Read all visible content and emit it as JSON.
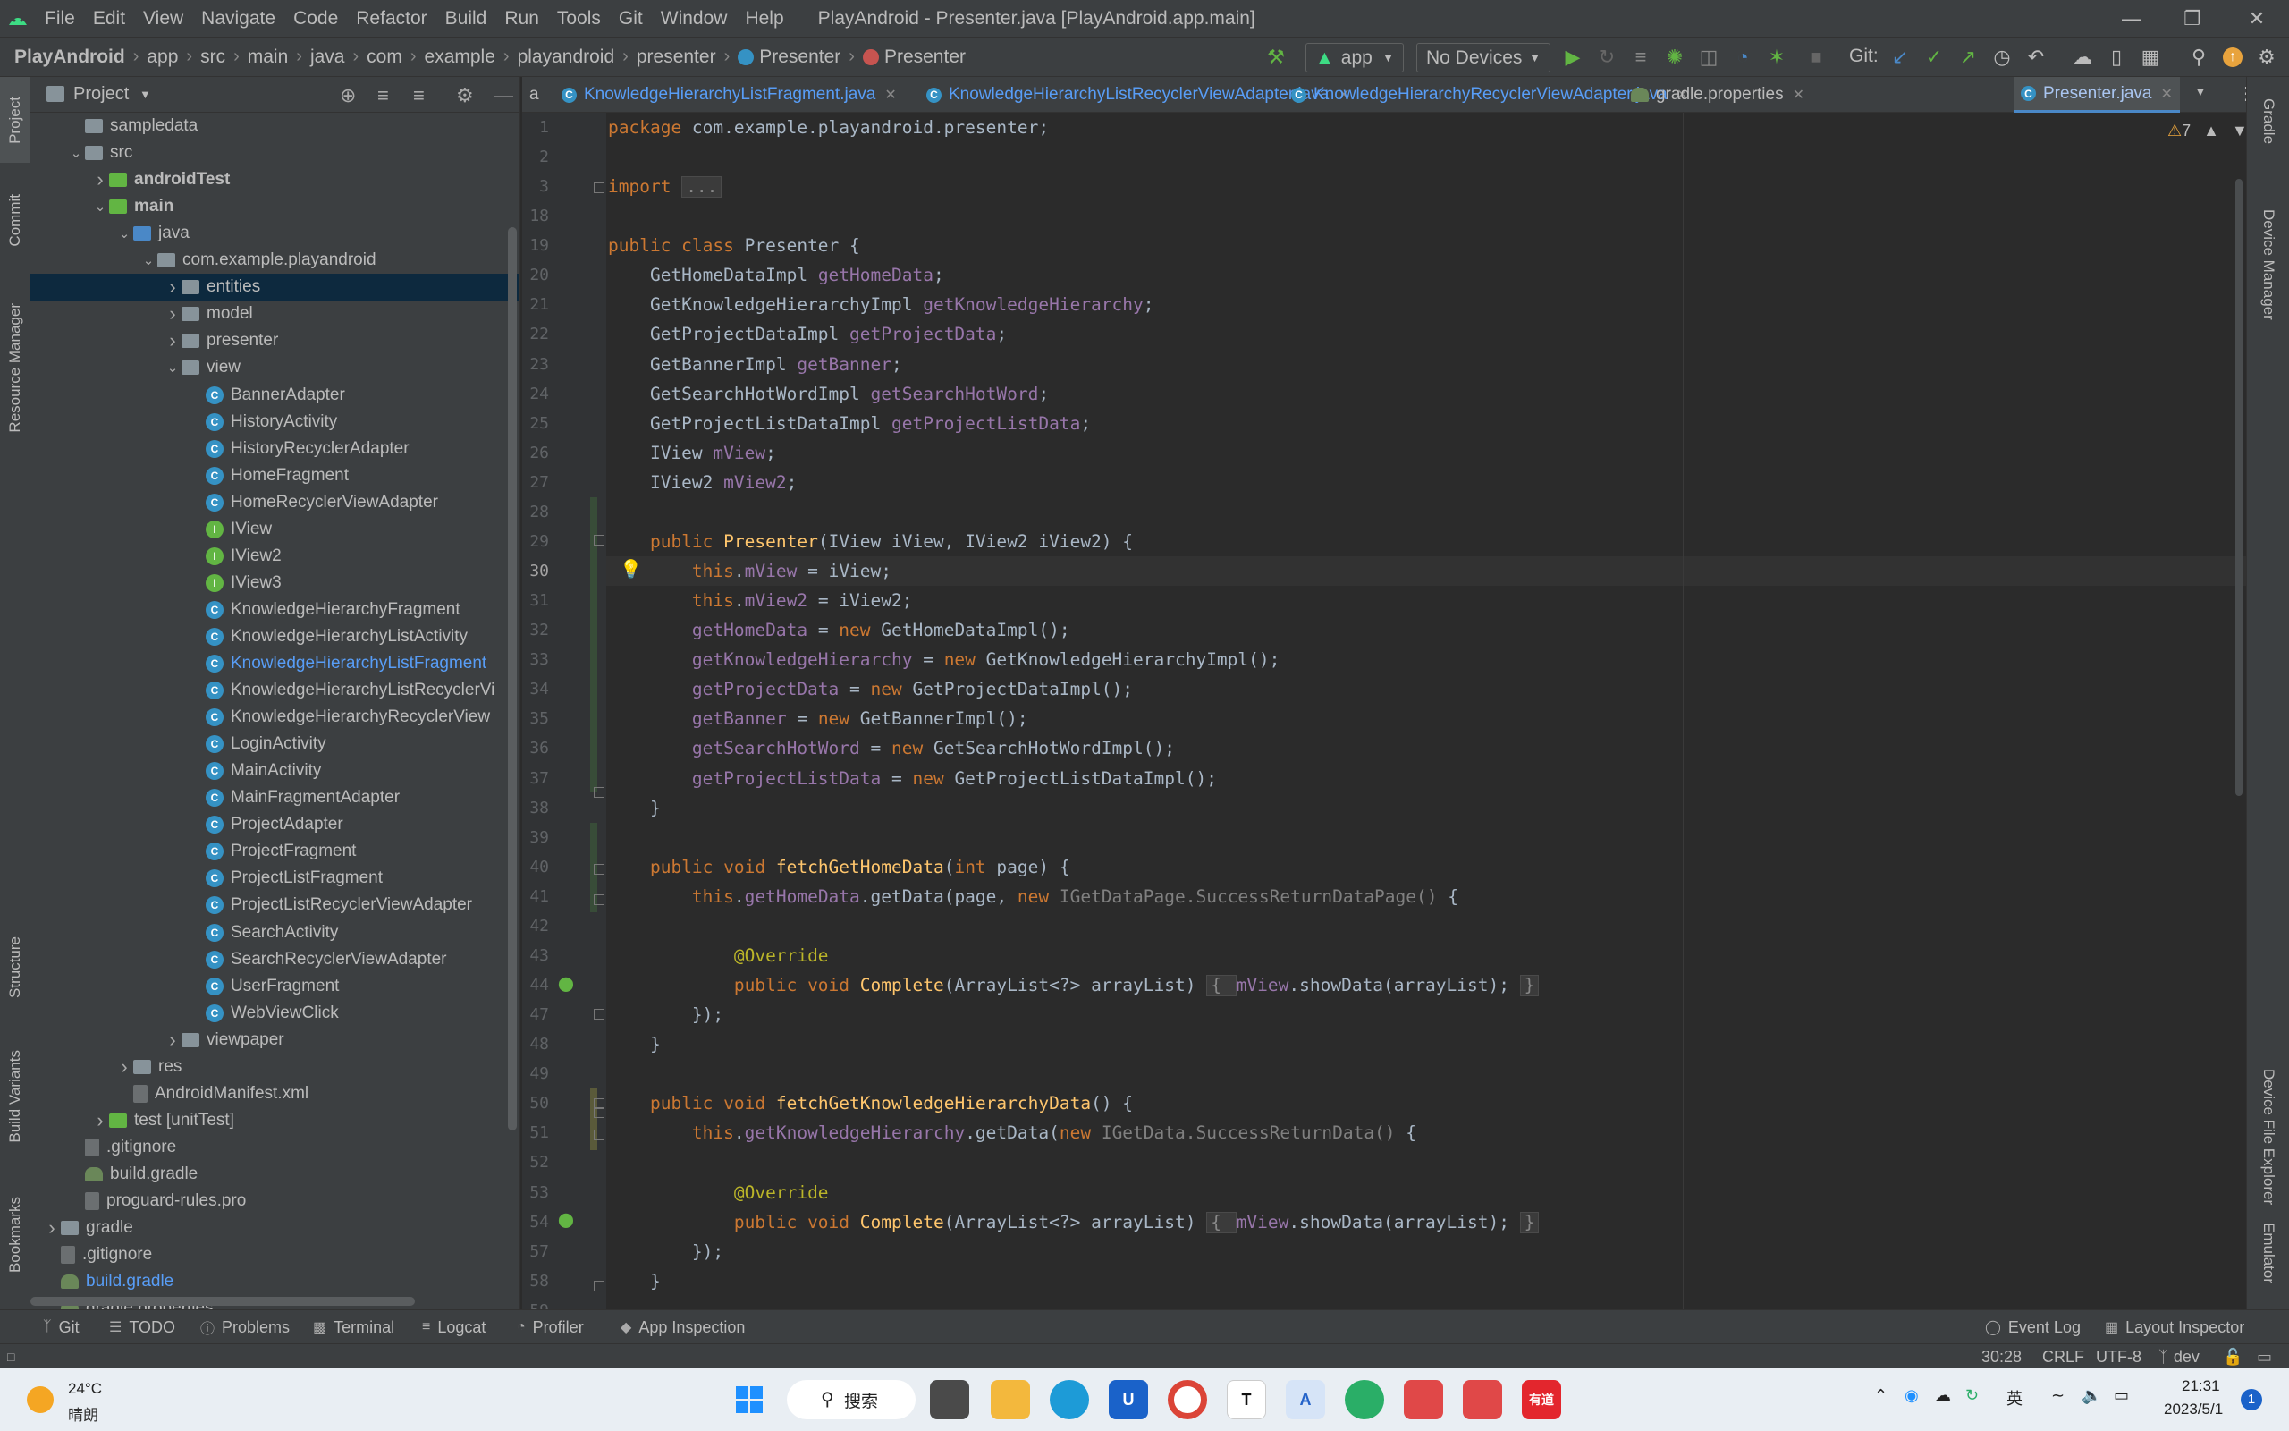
{
  "menu": {
    "items": [
      "File",
      "Edit",
      "View",
      "Navigate",
      "Code",
      "Refactor",
      "Build",
      "Run",
      "Tools",
      "Git",
      "Window",
      "Help"
    ],
    "window_title": "PlayAndroid - Presenter.java [PlayAndroid.app.main]"
  },
  "nav": {
    "breadcrumbs": [
      "PlayAndroid",
      "app",
      "src",
      "main",
      "java",
      "com",
      "example",
      "playandroid",
      "presenter"
    ],
    "class_crumb": "Presenter",
    "member_crumb": "Presenter",
    "run_config": "app",
    "device": "No Devices",
    "git_label": "Git:"
  },
  "left_stripe": {
    "tabs": [
      "Project",
      "Commit",
      "Resource Manager",
      "Structure",
      "Build Variants",
      "Bookmarks"
    ]
  },
  "project": {
    "title": "Project",
    "tree": [
      {
        "label": "sampledata",
        "indent": 1,
        "icon": "folder",
        "arrow": ""
      },
      {
        "label": "src",
        "indent": 1,
        "icon": "folder",
        "arrow": "v"
      },
      {
        "label": "androidTest",
        "indent": 2,
        "icon": "folder-green",
        "arrow": ">",
        "bold": true
      },
      {
        "label": "main",
        "indent": 2,
        "icon": "folder-green",
        "arrow": "v",
        "bold": true
      },
      {
        "label": "java",
        "indent": 3,
        "icon": "folder-blue",
        "arrow": "v"
      },
      {
        "label": "com.example.playandroid",
        "indent": 4,
        "icon": "folder",
        "arrow": "v"
      },
      {
        "label": "entities",
        "indent": 5,
        "icon": "folder",
        "arrow": ">",
        "selected": true
      },
      {
        "label": "model",
        "indent": 5,
        "icon": "folder",
        "arrow": ">"
      },
      {
        "label": "presenter",
        "indent": 5,
        "icon": "folder",
        "arrow": ">"
      },
      {
        "label": "view",
        "indent": 5,
        "icon": "folder",
        "arrow": "v"
      },
      {
        "label": "BannerAdapter",
        "indent": 6,
        "icon": "class"
      },
      {
        "label": "HistoryActivity",
        "indent": 6,
        "icon": "class"
      },
      {
        "label": "HistoryRecyclerAdapter",
        "indent": 6,
        "icon": "class"
      },
      {
        "label": "HomeFragment",
        "indent": 6,
        "icon": "class"
      },
      {
        "label": "HomeRecyclerViewAdapter",
        "indent": 6,
        "icon": "class"
      },
      {
        "label": "IView",
        "indent": 6,
        "icon": "interface"
      },
      {
        "label": "IView2",
        "indent": 6,
        "icon": "interface"
      },
      {
        "label": "IView3",
        "indent": 6,
        "icon": "interface"
      },
      {
        "label": "KnowledgeHierarchyFragment",
        "indent": 6,
        "icon": "class"
      },
      {
        "label": "KnowledgeHierarchyListActivity",
        "indent": 6,
        "icon": "class"
      },
      {
        "label": "KnowledgeHierarchyListFragment",
        "indent": 6,
        "icon": "class",
        "highlight": true
      },
      {
        "label": "KnowledgeHierarchyListRecyclerVi",
        "indent": 6,
        "icon": "class"
      },
      {
        "label": "KnowledgeHierarchyRecyclerView",
        "indent": 6,
        "icon": "class"
      },
      {
        "label": "LoginActivity",
        "indent": 6,
        "icon": "class"
      },
      {
        "label": "MainActivity",
        "indent": 6,
        "icon": "class"
      },
      {
        "label": "MainFragmentAdapter",
        "indent": 6,
        "icon": "class"
      },
      {
        "label": "ProjectAdapter",
        "indent": 6,
        "icon": "class"
      },
      {
        "label": "ProjectFragment",
        "indent": 6,
        "icon": "class"
      },
      {
        "label": "ProjectListFragment",
        "indent": 6,
        "icon": "class"
      },
      {
        "label": "ProjectListRecyclerViewAdapter",
        "indent": 6,
        "icon": "class"
      },
      {
        "label": "SearchActivity",
        "indent": 6,
        "icon": "class"
      },
      {
        "label": "SearchRecyclerViewAdapter",
        "indent": 6,
        "icon": "class"
      },
      {
        "label": "UserFragment",
        "indent": 6,
        "icon": "class"
      },
      {
        "label": "WebViewClick",
        "indent": 6,
        "icon": "class"
      },
      {
        "label": "viewpaper",
        "indent": 5,
        "icon": "folder",
        "arrow": ">"
      },
      {
        "label": "res",
        "indent": 3,
        "icon": "folder",
        "arrow": ">"
      },
      {
        "label": "AndroidManifest.xml",
        "indent": 3,
        "icon": "file"
      },
      {
        "label": "test [unitTest]",
        "indent": 2,
        "icon": "folder-green",
        "arrow": ">"
      },
      {
        "label": ".gitignore",
        "indent": 1,
        "icon": "file"
      },
      {
        "label": "build.gradle",
        "indent": 1,
        "icon": "gradle"
      },
      {
        "label": "proguard-rules.pro",
        "indent": 1,
        "icon": "file"
      },
      {
        "label": "gradle",
        "indent": 0,
        "icon": "folder",
        "arrow": ">"
      },
      {
        "label": ".gitignore",
        "indent": 0,
        "icon": "file"
      },
      {
        "label": "build.gradle",
        "indent": 0,
        "icon": "gradle",
        "highlight": true
      },
      {
        "label": "gradle.properties",
        "indent": 0,
        "icon": "gradle"
      }
    ]
  },
  "tabs": [
    {
      "label": "a",
      "partial": true
    },
    {
      "label": "KnowledgeHierarchyListFragment.java"
    },
    {
      "label": "KnowledgeHierarchyListRecyclerViewAdapter.java"
    },
    {
      "label": "KnowledgeHierarchyRecyclerViewAdapter.java"
    },
    {
      "label": "gradle.properties",
      "gradle": true
    },
    {
      "label": "Presenter.java",
      "active": true
    }
  ],
  "editor": {
    "warning_count": "7",
    "current_line": "30",
    "lines": [
      {
        "n": "1",
        "html": "<span class=\"kw\">package </span>com.example.playandroid.presenter;"
      },
      {
        "n": "2",
        "html": ""
      },
      {
        "n": "3",
        "html": "<span class=\"kw\">import </span><span class=\"fold\">...</span>"
      },
      {
        "n": "18",
        "html": ""
      },
      {
        "n": "19",
        "html": "<span class=\"kw\">public class </span>Presenter {"
      },
      {
        "n": "20",
        "html": "    GetHomeDataImpl <span class=\"fld\">getHomeData</span>;"
      },
      {
        "n": "21",
        "html": "    GetKnowledgeHierarchyImpl <span class=\"fld\">getKnowledgeHierarchy</span>;"
      },
      {
        "n": "22",
        "html": "    GetProjectDataImpl <span class=\"fld\">getProjectData</span>;"
      },
      {
        "n": "23",
        "html": "    GetBannerImpl <span class=\"fld\">getBanner</span>;"
      },
      {
        "n": "24",
        "html": "    GetSearchHotWordImpl <span class=\"fld\">getSearchHotWord</span>;"
      },
      {
        "n": "25",
        "html": "    GetProjectListDataImpl <span class=\"fld\">getProjectListData</span>;"
      },
      {
        "n": "26",
        "html": "    IView <span class=\"fld\">mView</span>;"
      },
      {
        "n": "27",
        "html": "    IView2 <span class=\"fld\">mView2</span>;"
      },
      {
        "n": "28",
        "html": ""
      },
      {
        "n": "29",
        "html": "    <span class=\"kw\">public </span><span class=\"fn\">Presenter</span>(IView iView, IView2 iView2) {"
      },
      {
        "n": "30",
        "html": "        <span class=\"kw\">this</span>.<span class=\"fld\">mView </span>= iView;"
      },
      {
        "n": "31",
        "html": "        <span class=\"kw\">this</span>.<span class=\"fld\">mView2 </span>= iView2;"
      },
      {
        "n": "32",
        "html": "        <span class=\"fld\">getHomeData </span>= <span class=\"kw\">new </span>GetHomeDataImpl();"
      },
      {
        "n": "33",
        "html": "        <span class=\"fld\">getKnowledgeHierarchy </span>= <span class=\"kw\">new </span>GetKnowledgeHierarchyImpl();"
      },
      {
        "n": "34",
        "html": "        <span class=\"fld\">getProjectData </span>= <span class=\"kw\">new </span>GetProjectDataImpl();"
      },
      {
        "n": "35",
        "html": "        <span class=\"fld\">getBanner </span>= <span class=\"kw\">new </span>GetBannerImpl();"
      },
      {
        "n": "36",
        "html": "        <span class=\"fld\">getSearchHotWord </span>= <span class=\"kw\">new </span>GetSearchHotWordImpl();"
      },
      {
        "n": "37",
        "html": "        <span class=\"fld\">getProjectListData </span>= <span class=\"kw\">new </span>GetProjectListDataImpl();"
      },
      {
        "n": "38",
        "html": "    }"
      },
      {
        "n": "39",
        "html": ""
      },
      {
        "n": "40",
        "html": "    <span class=\"kw\">public void </span><span class=\"fn\">fetchGetHomeData</span>(<span class=\"kw\">int </span>page) {"
      },
      {
        "n": "41",
        "html": "        <span class=\"kw\">this</span>.<span class=\"fld\">getHomeData</span>.getData(page, <span class=\"kw\">new </span><span class=\"gray\">IGetDataPage.SuccessReturnDataPage() </span>{"
      },
      {
        "n": "42",
        "html": ""
      },
      {
        "n": "43",
        "html": "            <span class=\"ann\">@Override</span>"
      },
      {
        "n": "44",
        "html": "            <span class=\"kw\">public void </span><span class=\"fn\">Complete</span>(ArrayList&lt;?&gt; arrayList) <span class=\"fold\">{ </span><span class=\"fld\">mView</span>.showData(arrayList); <span class=\"fold\">}</span>"
      },
      {
        "n": "47",
        "html": "        });"
      },
      {
        "n": "48",
        "html": "    }"
      },
      {
        "n": "49",
        "html": ""
      },
      {
        "n": "50",
        "html": "    <span class=\"kw\">public void </span><span class=\"fn\">fetchGetKnowledgeHierarchyData</span>() {"
      },
      {
        "n": "51",
        "html": "        <span class=\"kw\">this</span>.<span class=\"fld\">getKnowledgeHierarchy</span>.getData(<span class=\"kw\">new </span><span class=\"gray\">IGetData.SuccessReturnData() </span>{"
      },
      {
        "n": "52",
        "html": ""
      },
      {
        "n": "53",
        "html": "            <span class=\"ann\">@Override</span>"
      },
      {
        "n": "54",
        "html": "            <span class=\"kw\">public void </span><span class=\"fn\">Complete</span>(ArrayList&lt;?&gt; arrayList) <span class=\"fold\">{ </span><span class=\"fld\">mView</span>.showData(arrayList); <span class=\"fold\">}</span>"
      },
      {
        "n": "57",
        "html": "        });"
      },
      {
        "n": "58",
        "html": "    }"
      },
      {
        "n": "59",
        "html": ""
      }
    ]
  },
  "right_stripe": {
    "tabs": [
      "Gradle",
      "Device Manager",
      "Device File Explorer",
      "Emulator"
    ]
  },
  "bottom_tools": [
    "Git",
    "TODO",
    "Problems",
    "Terminal",
    "Logcat",
    "Profiler",
    "App Inspection"
  ],
  "bottom_right_tools": [
    "Event Log",
    "Layout Inspector"
  ],
  "status": {
    "position": "30:28",
    "line_sep": "CRLF",
    "encoding": "UTF-8",
    "branch": "dev"
  },
  "taskbar": {
    "weather_temp": "24°C",
    "weather_desc": "晴朗",
    "search_label": "搜索",
    "ime": "英",
    "time": "21:31",
    "date": "2023/5/1",
    "notif": "1",
    "youdao_label": "有道"
  }
}
